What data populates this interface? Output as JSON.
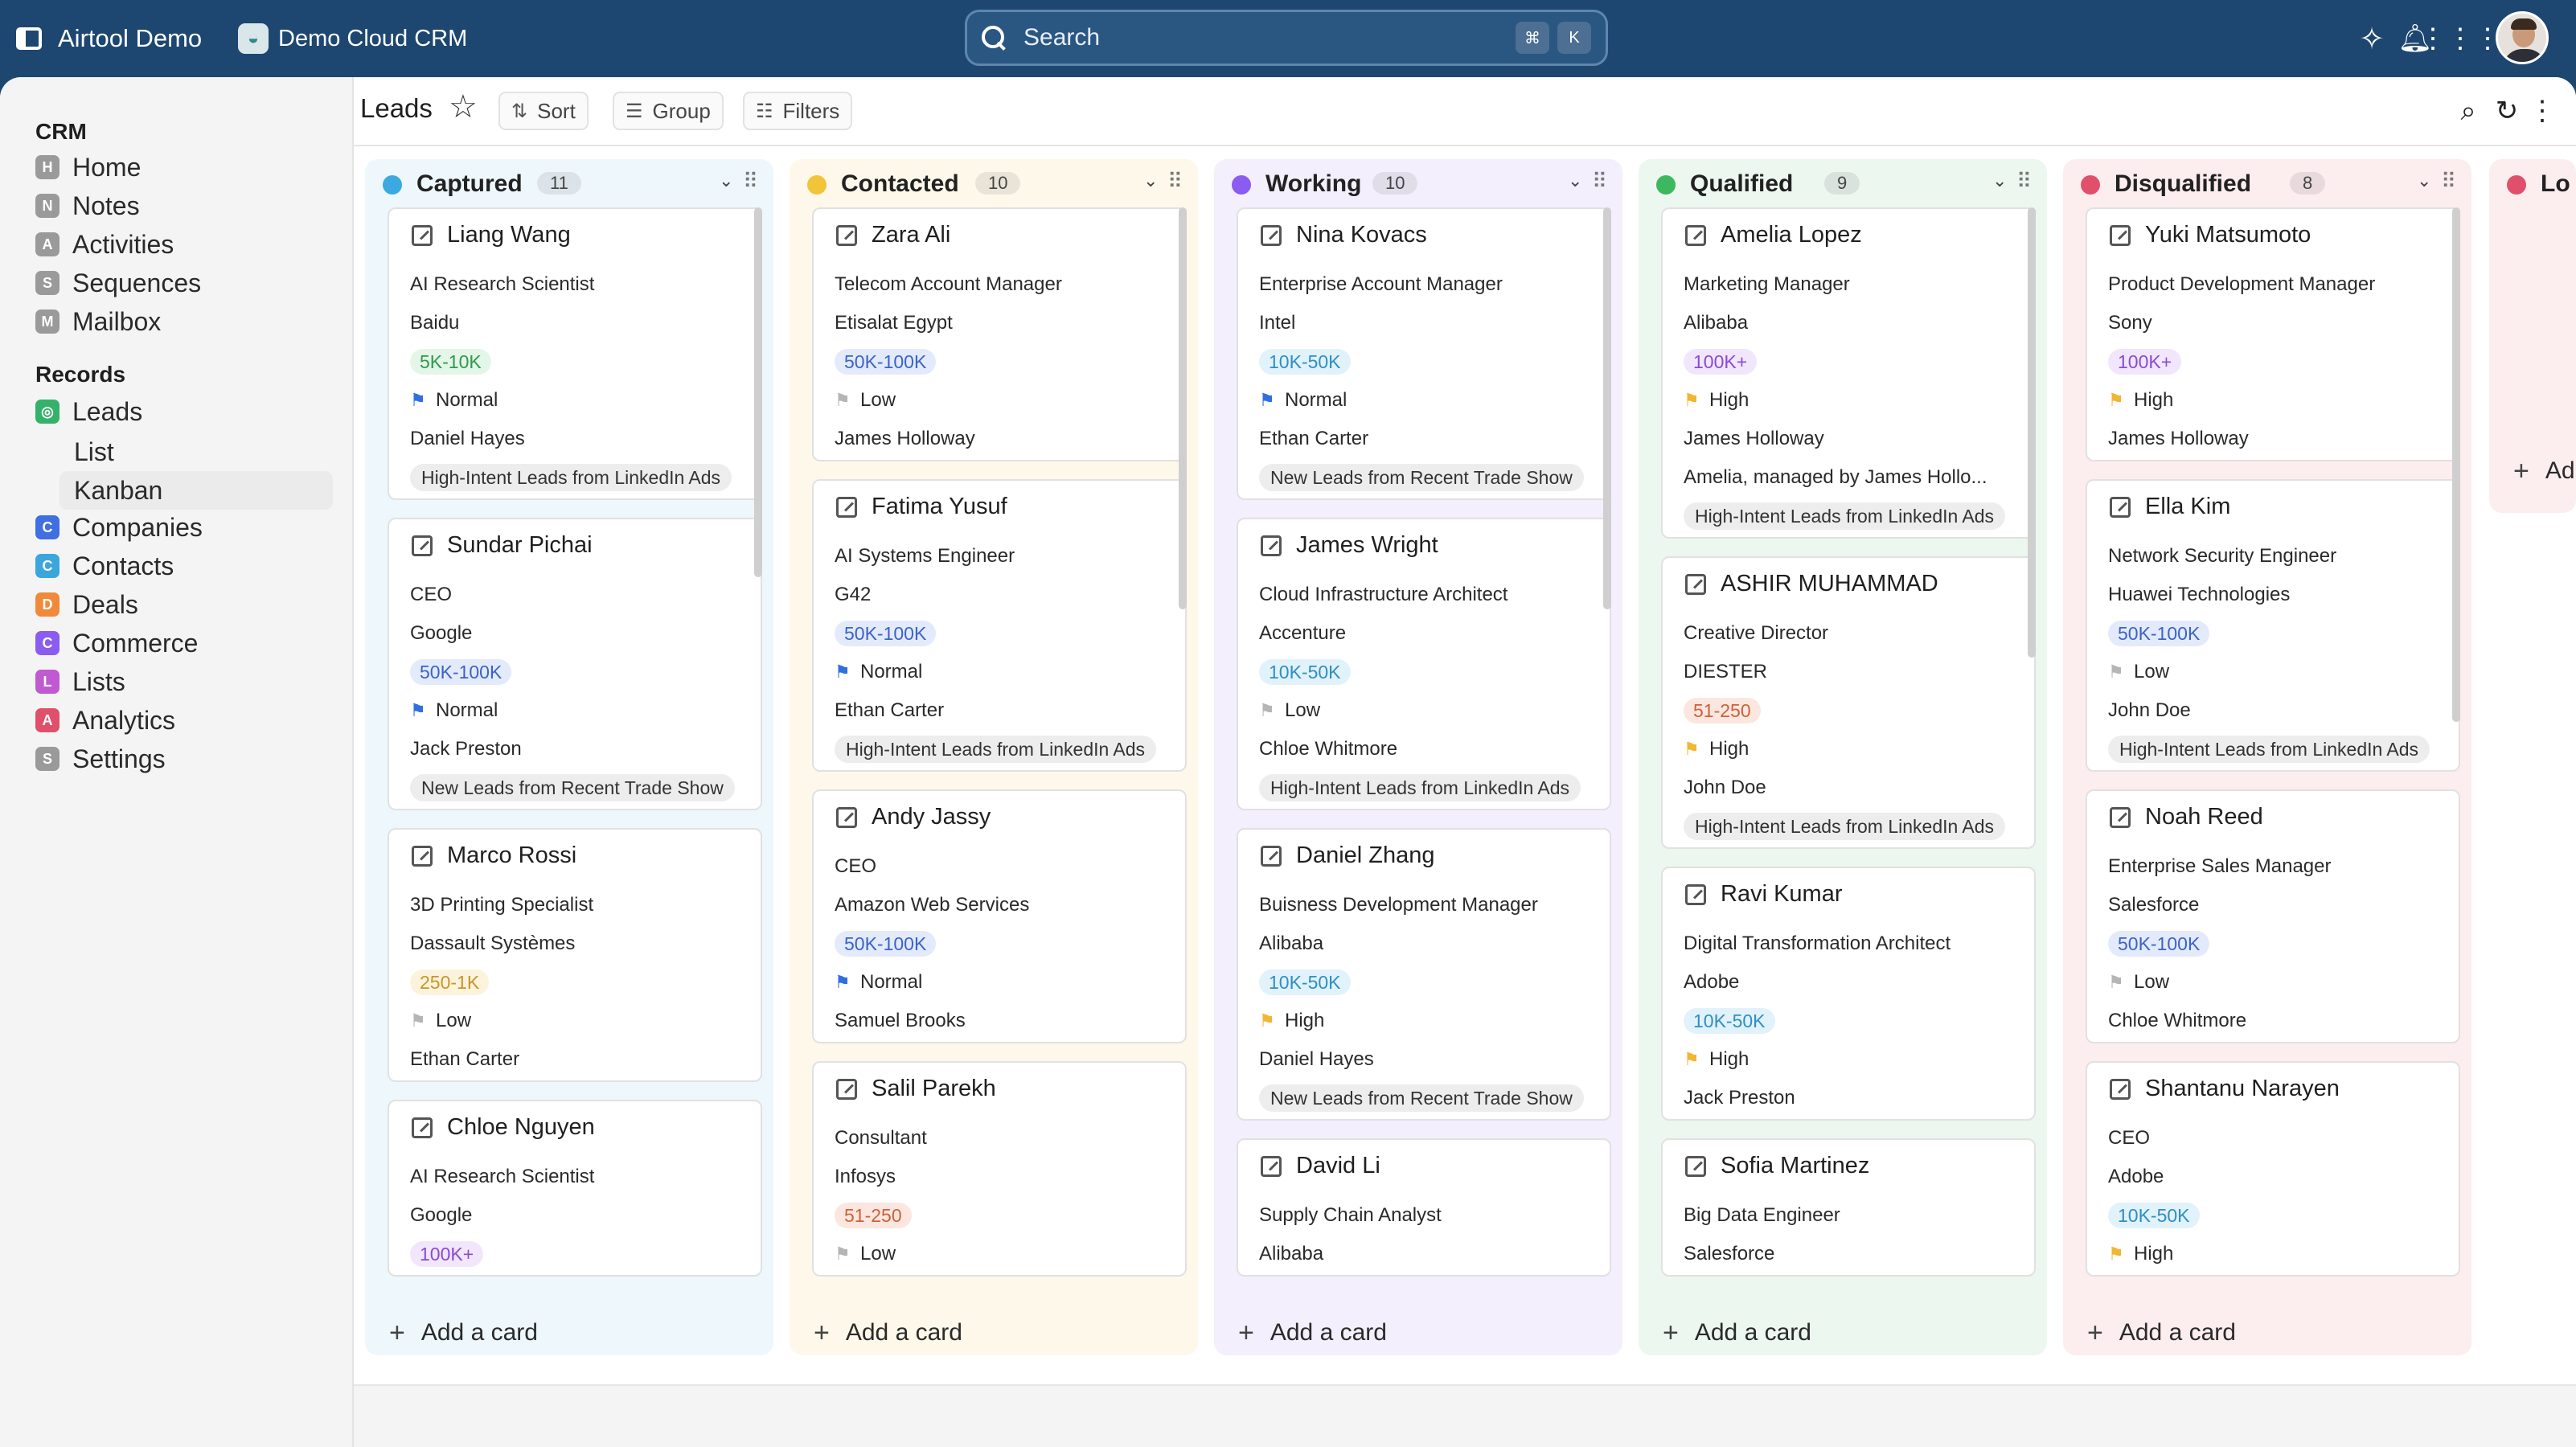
{
  "topbar": {
    "app_title": "Airtool Demo",
    "workspace_name": "Demo Cloud CRM",
    "search_placeholder": "Search",
    "shortcut_key1": "⌘",
    "shortcut_key2": "K",
    "icons": [
      "sparkle-icon",
      "bell-icon",
      "apps-grid-icon"
    ]
  },
  "sidebar": {
    "crm_title": "CRM",
    "crm_items": [
      {
        "label": "Home",
        "icon": "home-icon",
        "color": "#9a9a9a"
      },
      {
        "label": "Notes",
        "icon": "notes-icon",
        "color": "#9a9a9a"
      },
      {
        "label": "Activities",
        "icon": "activities-icon",
        "color": "#9a9a9a"
      },
      {
        "label": "Sequences",
        "icon": "sequences-icon",
        "color": "#9a9a9a"
      },
      {
        "label": "Mailbox",
        "icon": "mailbox-icon",
        "color": "#9a9a9a"
      }
    ],
    "records_title": "Records",
    "leads_label": "Leads",
    "leads_sub": [
      "List",
      "Kanban"
    ],
    "record_items": [
      {
        "label": "Companies",
        "icon": "companies-icon",
        "color": "#3f6fe0"
      },
      {
        "label": "Contacts",
        "icon": "contacts-icon",
        "color": "#3ba6db"
      },
      {
        "label": "Deals",
        "icon": "deals-icon",
        "color": "#f08a3a"
      },
      {
        "label": "Commerce",
        "icon": "commerce-icon",
        "color": "#8a5cf0"
      },
      {
        "label": "Lists",
        "icon": "lists-icon",
        "color": "#c05ad0"
      },
      {
        "label": "Analytics",
        "icon": "analytics-icon",
        "color": "#e0506a"
      },
      {
        "label": "Settings",
        "icon": "settings-icon",
        "color": "#9a9a9a"
      }
    ]
  },
  "toolbar": {
    "title": "Leads",
    "sort_label": "Sort",
    "group_label": "Group",
    "filters_label": "Filters"
  },
  "board": {
    "add_card_label": "Add a card",
    "columns": [
      {
        "name": "Captured",
        "count": "11",
        "dot": "#3ca9e0",
        "bg": "#eef7fc",
        "cards": [
          {
            "name": "Liang Wang",
            "rows": [
              {
                "t": "text",
                "v": "AI Research Scientist"
              },
              {
                "t": "text",
                "v": "Baidu"
              },
              {
                "t": "badge",
                "v": "5K-10K",
                "color": "#2f9a4a",
                "bg": "#e4f6e8"
              },
              {
                "t": "flag",
                "v": "Normal",
                "color": "#2f6fe0"
              },
              {
                "t": "text",
                "v": "Daniel Hayes"
              },
              {
                "t": "pill",
                "v": "High-Intent Leads from LinkedIn Ads"
              }
            ]
          },
          {
            "name": "Sundar Pichai",
            "rows": [
              {
                "t": "text",
                "v": "CEO"
              },
              {
                "t": "text",
                "v": "Google"
              },
              {
                "t": "badge",
                "v": "50K-100K",
                "color": "#3b63c9",
                "bg": "#e3eafb"
              },
              {
                "t": "flag",
                "v": "Normal",
                "color": "#2f6fe0"
              },
              {
                "t": "text",
                "v": "Jack Preston"
              },
              {
                "t": "pill",
                "v": "New Leads from Recent Trade Show"
              }
            ]
          },
          {
            "name": "Marco Rossi",
            "rows": [
              {
                "t": "text",
                "v": "3D Printing Specialist"
              },
              {
                "t": "text",
                "v": "Dassault Systèmes"
              },
              {
                "t": "badge",
                "v": "250-1K",
                "color": "#c9952a",
                "bg": "#fcf3dc"
              },
              {
                "t": "flag",
                "v": "Low",
                "color": "#b5b5b5"
              },
              {
                "t": "text",
                "v": "Ethan Carter"
              }
            ]
          },
          {
            "name": "Chloe Nguyen",
            "rows": [
              {
                "t": "text",
                "v": "AI Research Scientist"
              },
              {
                "t": "text",
                "v": "Google"
              },
              {
                "t": "badge",
                "v": "100K+",
                "color": "#8a4bd6",
                "bg": "#f1e6fb"
              }
            ]
          }
        ]
      },
      {
        "name": "Contacted",
        "count": "10",
        "dot": "#f2c437",
        "bg": "#fdf8ea",
        "cards": [
          {
            "name": "Zara Ali",
            "rows": [
              {
                "t": "text",
                "v": "Telecom Account Manager"
              },
              {
                "t": "text",
                "v": "Etisalat Egypt"
              },
              {
                "t": "badge",
                "v": "50K-100K",
                "color": "#3b63c9",
                "bg": "#e3eafb"
              },
              {
                "t": "flag",
                "v": "Low",
                "color": "#b5b5b5"
              },
              {
                "t": "text",
                "v": "James Holloway"
              }
            ]
          },
          {
            "name": "Fatima Yusuf",
            "rows": [
              {
                "t": "text",
                "v": "AI Systems Engineer"
              },
              {
                "t": "text",
                "v": "G42"
              },
              {
                "t": "badge",
                "v": "50K-100K",
                "color": "#3b63c9",
                "bg": "#e3eafb"
              },
              {
                "t": "flag",
                "v": "Normal",
                "color": "#2f6fe0"
              },
              {
                "t": "text",
                "v": "Ethan Carter"
              },
              {
                "t": "pill",
                "v": "High-Intent Leads from LinkedIn Ads"
              }
            ]
          },
          {
            "name": "Andy Jassy",
            "rows": [
              {
                "t": "text",
                "v": "CEO"
              },
              {
                "t": "text",
                "v": "Amazon Web Services"
              },
              {
                "t": "badge",
                "v": "50K-100K",
                "color": "#3b63c9",
                "bg": "#e3eafb"
              },
              {
                "t": "flag",
                "v": "Normal",
                "color": "#2f6fe0"
              },
              {
                "t": "text",
                "v": "Samuel Brooks"
              }
            ]
          },
          {
            "name": "Salil Parekh",
            "rows": [
              {
                "t": "text",
                "v": "Consultant"
              },
              {
                "t": "text",
                "v": "Infosys"
              },
              {
                "t": "badge",
                "v": "51-250",
                "color": "#d0603a",
                "bg": "#fbe7df"
              },
              {
                "t": "flag",
                "v": "Low",
                "color": "#b5b5b5"
              }
            ]
          }
        ]
      },
      {
        "name": "Working",
        "count": "10",
        "dot": "#8a5cf0",
        "bg": "#f3effc",
        "cards": [
          {
            "name": "Nina Kovacs",
            "rows": [
              {
                "t": "text",
                "v": "Enterprise Account Manager"
              },
              {
                "t": "text",
                "v": "Intel"
              },
              {
                "t": "badge",
                "v": "10K-50K",
                "color": "#2e8fc4",
                "bg": "#e1f2fb"
              },
              {
                "t": "flag",
                "v": "Normal",
                "color": "#2f6fe0"
              },
              {
                "t": "text",
                "v": "Ethan Carter"
              },
              {
                "t": "pill",
                "v": "New Leads from Recent Trade Show"
              }
            ]
          },
          {
            "name": "James Wright",
            "rows": [
              {
                "t": "text",
                "v": "Cloud Infrastructure Architect"
              },
              {
                "t": "text",
                "v": "Accenture"
              },
              {
                "t": "badge",
                "v": "10K-50K",
                "color": "#2e8fc4",
                "bg": "#e1f2fb"
              },
              {
                "t": "flag",
                "v": "Low",
                "color": "#b5b5b5"
              },
              {
                "t": "text",
                "v": "Chloe Whitmore"
              },
              {
                "t": "pill",
                "v": "High-Intent Leads from LinkedIn Ads"
              }
            ]
          },
          {
            "name": "Daniel Zhang",
            "rows": [
              {
                "t": "text",
                "v": "Buisness Development Manager"
              },
              {
                "t": "text",
                "v": "Alibaba"
              },
              {
                "t": "badge",
                "v": "10K-50K",
                "color": "#2e8fc4",
                "bg": "#e1f2fb"
              },
              {
                "t": "flag",
                "v": "High",
                "color": "#f2b632"
              },
              {
                "t": "text",
                "v": "Daniel Hayes"
              },
              {
                "t": "pill",
                "v": "New Leads from Recent Trade Show"
              }
            ]
          },
          {
            "name": "David Li",
            "rows": [
              {
                "t": "text",
                "v": "Supply Chain Analyst"
              },
              {
                "t": "text",
                "v": "Alibaba"
              }
            ]
          }
        ]
      },
      {
        "name": "Qualified",
        "count": "9",
        "dot": "#3cb960",
        "bg": "#ecf7ef",
        "cards": [
          {
            "name": "Amelia Lopez",
            "rows": [
              {
                "t": "text",
                "v": "Marketing Manager"
              },
              {
                "t": "text",
                "v": "Alibaba"
              },
              {
                "t": "badge",
                "v": "100K+",
                "color": "#8a4bd6",
                "bg": "#f1e6fb"
              },
              {
                "t": "flag",
                "v": "High",
                "color": "#f2b632"
              },
              {
                "t": "text",
                "v": "James Holloway"
              },
              {
                "t": "text",
                "v": "Amelia, managed by James Hollo..."
              },
              {
                "t": "pill",
                "v": "High-Intent Leads from LinkedIn Ads"
              }
            ]
          },
          {
            "name": "ASHIR MUHAMMAD",
            "rows": [
              {
                "t": "text",
                "v": "Creative Director"
              },
              {
                "t": "text",
                "v": "DIESTER"
              },
              {
                "t": "badge",
                "v": "51-250",
                "color": "#d0603a",
                "bg": "#fbe7df"
              },
              {
                "t": "flag",
                "v": "High",
                "color": "#f2b632"
              },
              {
                "t": "text",
                "v": "John Doe"
              },
              {
                "t": "pill",
                "v": "High-Intent Leads from LinkedIn Ads"
              }
            ]
          },
          {
            "name": "Ravi Kumar",
            "rows": [
              {
                "t": "text",
                "v": "Digital Transformation Architect"
              },
              {
                "t": "text",
                "v": "Adobe"
              },
              {
                "t": "badge",
                "v": "10K-50K",
                "color": "#2e8fc4",
                "bg": "#e1f2fb"
              },
              {
                "t": "flag",
                "v": "High",
                "color": "#f2b632"
              },
              {
                "t": "text",
                "v": "Jack Preston"
              }
            ]
          },
          {
            "name": "Sofia Martinez",
            "rows": [
              {
                "t": "text",
                "v": "Big Data Engineer"
              },
              {
                "t": "text",
                "v": "Salesforce"
              }
            ]
          }
        ]
      },
      {
        "name": "Disqualified",
        "count": "8",
        "dot": "#e0506a",
        "bg": "#fcedef",
        "cards": [
          {
            "name": "Yuki Matsumoto",
            "rows": [
              {
                "t": "text",
                "v": "Product Development Manager"
              },
              {
                "t": "text",
                "v": "Sony"
              },
              {
                "t": "badge",
                "v": "100K+",
                "color": "#8a4bd6",
                "bg": "#f1e6fb"
              },
              {
                "t": "flag",
                "v": "High",
                "color": "#f2b632"
              },
              {
                "t": "text",
                "v": "James Holloway"
              }
            ]
          },
          {
            "name": "Ella Kim",
            "rows": [
              {
                "t": "text",
                "v": "Network Security Engineer"
              },
              {
                "t": "text",
                "v": "Huawei Technologies"
              },
              {
                "t": "badge",
                "v": "50K-100K",
                "color": "#3b63c9",
                "bg": "#e3eafb"
              },
              {
                "t": "flag",
                "v": "Low",
                "color": "#b5b5b5"
              },
              {
                "t": "text",
                "v": "John Doe"
              },
              {
                "t": "pill",
                "v": "High-Intent Leads from LinkedIn Ads"
              }
            ]
          },
          {
            "name": "Noah Reed",
            "rows": [
              {
                "t": "text",
                "v": "Enterprise Sales Manager"
              },
              {
                "t": "text",
                "v": "Salesforce"
              },
              {
                "t": "badge",
                "v": "50K-100K",
                "color": "#3b63c9",
                "bg": "#e3eafb"
              },
              {
                "t": "flag",
                "v": "Low",
                "color": "#b5b5b5"
              },
              {
                "t": "text",
                "v": "Chloe Whitmore"
              }
            ]
          },
          {
            "name": "Shantanu Narayen",
            "rows": [
              {
                "t": "text",
                "v": "CEO"
              },
              {
                "t": "text",
                "v": "Adobe"
              },
              {
                "t": "badge",
                "v": "10K-50K",
                "color": "#2e8fc4",
                "bg": "#e1f2fb"
              },
              {
                "t": "flag",
                "v": "High",
                "color": "#f2b632"
              }
            ]
          }
        ]
      }
    ],
    "partial_column": {
      "name": "Lo",
      "dot": "#e0506a",
      "bg": "#fcedef",
      "add_label": "Ad"
    }
  }
}
